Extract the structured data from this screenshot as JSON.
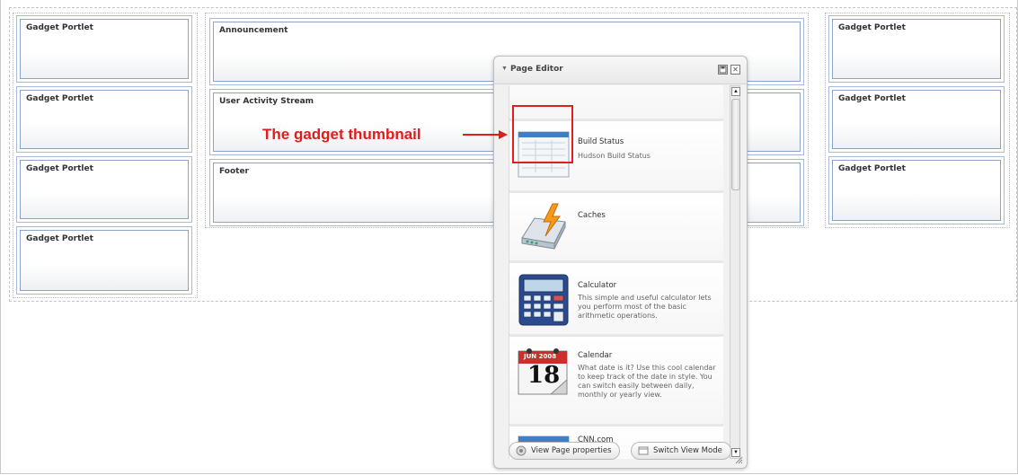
{
  "layout": {
    "left_column": [
      "Gadget Portlet",
      "Gadget Portlet",
      "Gadget Portlet",
      "Gadget Portlet"
    ],
    "middle_column": [
      "Announcement",
      "User Activity Stream",
      "Footer"
    ],
    "right_column": [
      "Gadget Portlet",
      "Gadget Portlet",
      "Gadget Portlet"
    ]
  },
  "editor": {
    "title": "Page Editor",
    "gadgets": [
      {
        "name": "Build Status",
        "description": "Hudson Build Status",
        "icon": "build-status-thumbnail-icon"
      },
      {
        "name": "Caches",
        "description": "",
        "icon": "caches-icon"
      },
      {
        "name": "Calculator",
        "description": "This simple and useful calculator lets you perform most of the basic arithmetic operations.",
        "icon": "calculator-icon"
      },
      {
        "name": "Calendar",
        "description": "What date is it? Use this cool calendar to keep track of the date in style. You can switch easily between daily, monthly or yearly view.",
        "icon": "calendar-icon"
      },
      {
        "name": "CNN.com",
        "description": "",
        "icon": "cnn-thumbnail-icon"
      }
    ],
    "calendar_icon": {
      "month": "JUN 2008",
      "day": "18"
    },
    "buttons": {
      "view_page_properties": "View Page properties",
      "switch_view_mode": "Switch View Mode"
    }
  },
  "annotation": {
    "label": "The gadget thumbnail",
    "color": "#e21b1b"
  }
}
